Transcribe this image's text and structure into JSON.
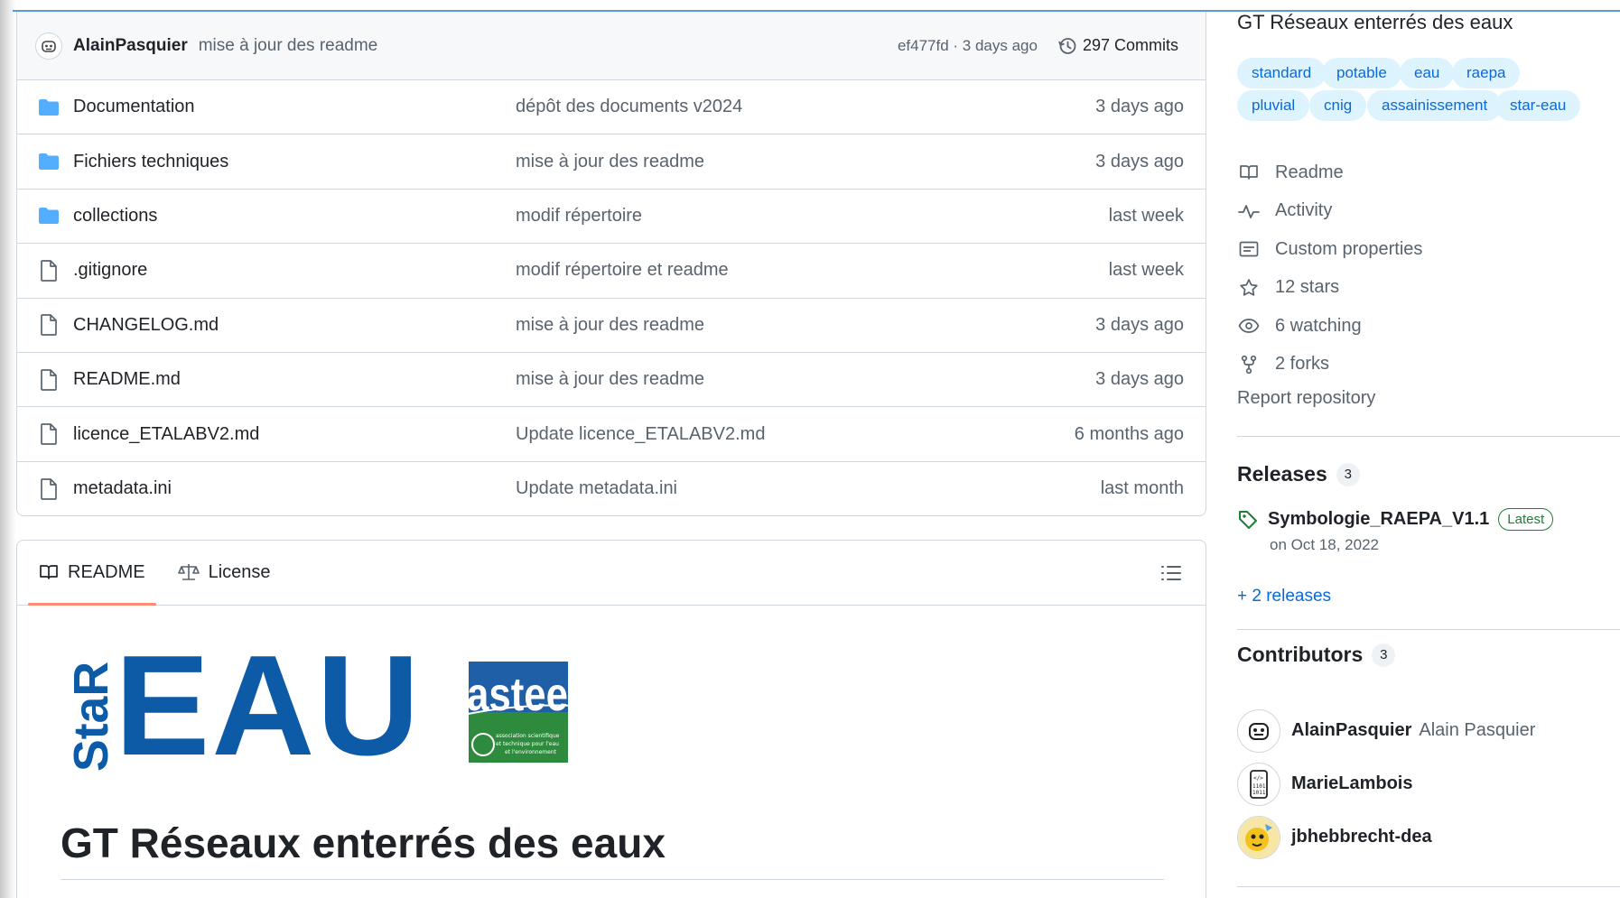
{
  "commit_bar": {
    "author": "AlainPasquier",
    "message": "mise à jour des readme",
    "meta": "ef477fd · 3 days ago",
    "commits": "297 Commits"
  },
  "files": [
    {
      "name": "Documentation",
      "type": "folder",
      "commit": "dépôt des documents v2024",
      "date": "3 days ago"
    },
    {
      "name": "Fichiers techniques",
      "type": "folder",
      "commit": "mise à jour des readme",
      "date": "3 days ago"
    },
    {
      "name": "collections",
      "type": "folder",
      "commit": "modif répertoire",
      "date": "last week"
    },
    {
      "name": ".gitignore",
      "type": "file",
      "commit": "modif répertoire et readme",
      "date": "last week"
    },
    {
      "name": "CHANGELOG.md",
      "type": "file",
      "commit": "mise à jour des readme",
      "date": "3 days ago"
    },
    {
      "name": "README.md",
      "type": "file",
      "commit": "mise à jour des readme",
      "date": "3 days ago"
    },
    {
      "name": "licence_ETALABV2.md",
      "type": "file",
      "commit": "Update licence_ETALABV2.md",
      "date": "6 months ago"
    },
    {
      "name": "metadata.ini",
      "type": "file",
      "commit": "Update metadata.ini",
      "date": "last month"
    }
  ],
  "readme": {
    "tabs": [
      "README",
      "License"
    ],
    "logo": {
      "star_vertical": "StaR",
      "eau": "EAU",
      "astee": "astee",
      "astee_sub": "association scientifique et technique pour l'eau et l'environnement"
    },
    "heading": "GT Réseaux enterrés des eaux"
  },
  "sidebar": {
    "about_title": "GT Réseaux enterrés des eaux",
    "topics": [
      "standard",
      "potable",
      "eau",
      "raepa",
      "pluvial",
      "cnig",
      "assainissement",
      "star-eau"
    ],
    "meta": [
      {
        "icon": "book-icon",
        "label": "Readme"
      },
      {
        "icon": "pulse-icon",
        "label": "Activity"
      },
      {
        "icon": "note-icon",
        "label": "Custom properties"
      },
      {
        "icon": "star-icon",
        "label": "12 stars"
      },
      {
        "icon": "eye-icon",
        "label": "6 watching"
      },
      {
        "icon": "fork-icon",
        "label": "2 forks"
      }
    ],
    "report": "Report repository",
    "releases": {
      "title": "Releases",
      "count": "3",
      "latest_name": "Symbologie_RAEPA_V1.1",
      "latest_badge": "Latest",
      "latest_date": "on Oct 18, 2022",
      "more": "+ 2 releases"
    },
    "contributors": {
      "title": "Contributors",
      "count": "3",
      "people": [
        {
          "login": "AlainPasquier",
          "name": "Alain Pasquier"
        },
        {
          "login": "MarieLambois",
          "name": ""
        },
        {
          "login": "jbhebbrecht-dea",
          "name": ""
        }
      ]
    }
  },
  "colors": {
    "accent_link": "#0969da",
    "topic_bg": "#ddf4ff",
    "folder": "#54aeff",
    "latest_green": "#1a7f37",
    "tab_underline": "#fd8c73",
    "eau_blue": "#0d5aa7",
    "astee_green": "#2e8b3d"
  }
}
